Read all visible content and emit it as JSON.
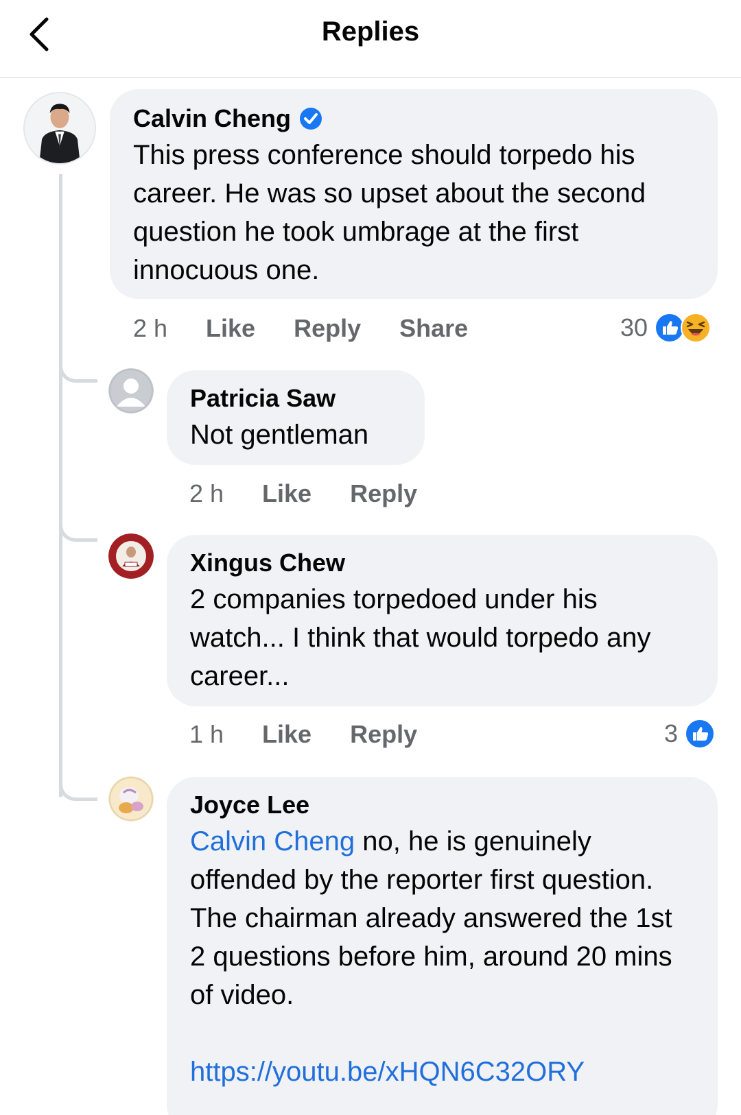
{
  "header": {
    "title": "Replies",
    "back_icon": "chevron-left-icon"
  },
  "comments": [
    {
      "author": "Calvin Cheng",
      "verified": true,
      "text": "This press conference should torpedo his career. He was so upset about the second question he took umbrage at the first innocuous one.",
      "time": "2 h",
      "like": "Like",
      "reply": "Reply",
      "share": "Share",
      "reaction_count": "30",
      "reactions": [
        "like-icon",
        "haha-icon"
      ]
    },
    {
      "author": "Patricia Saw",
      "text": "Not gentleman",
      "time": "2 h",
      "like": "Like",
      "reply": "Reply"
    },
    {
      "author": "Xingus Chew",
      "text": "2 companies torpedoed under his watch... I think that would torpedo any career...",
      "time": "1 h",
      "like": "Like",
      "reply": "Reply",
      "reaction_count": "3",
      "reactions": [
        "like-icon"
      ]
    },
    {
      "author": "Joyce Lee",
      "mention": "Calvin Cheng",
      "text": " no, he is genuinely offended by the reporter first question. The chairman already answered the 1st 2 questions before him, around 20 mins of video.",
      "link": "https://youtu.be/xHQN6C32ORY"
    }
  ],
  "colors": {
    "bubble": "#f0f2f5",
    "link": "#216fdb",
    "meta": "#65676b",
    "verified": "#1877f2"
  }
}
